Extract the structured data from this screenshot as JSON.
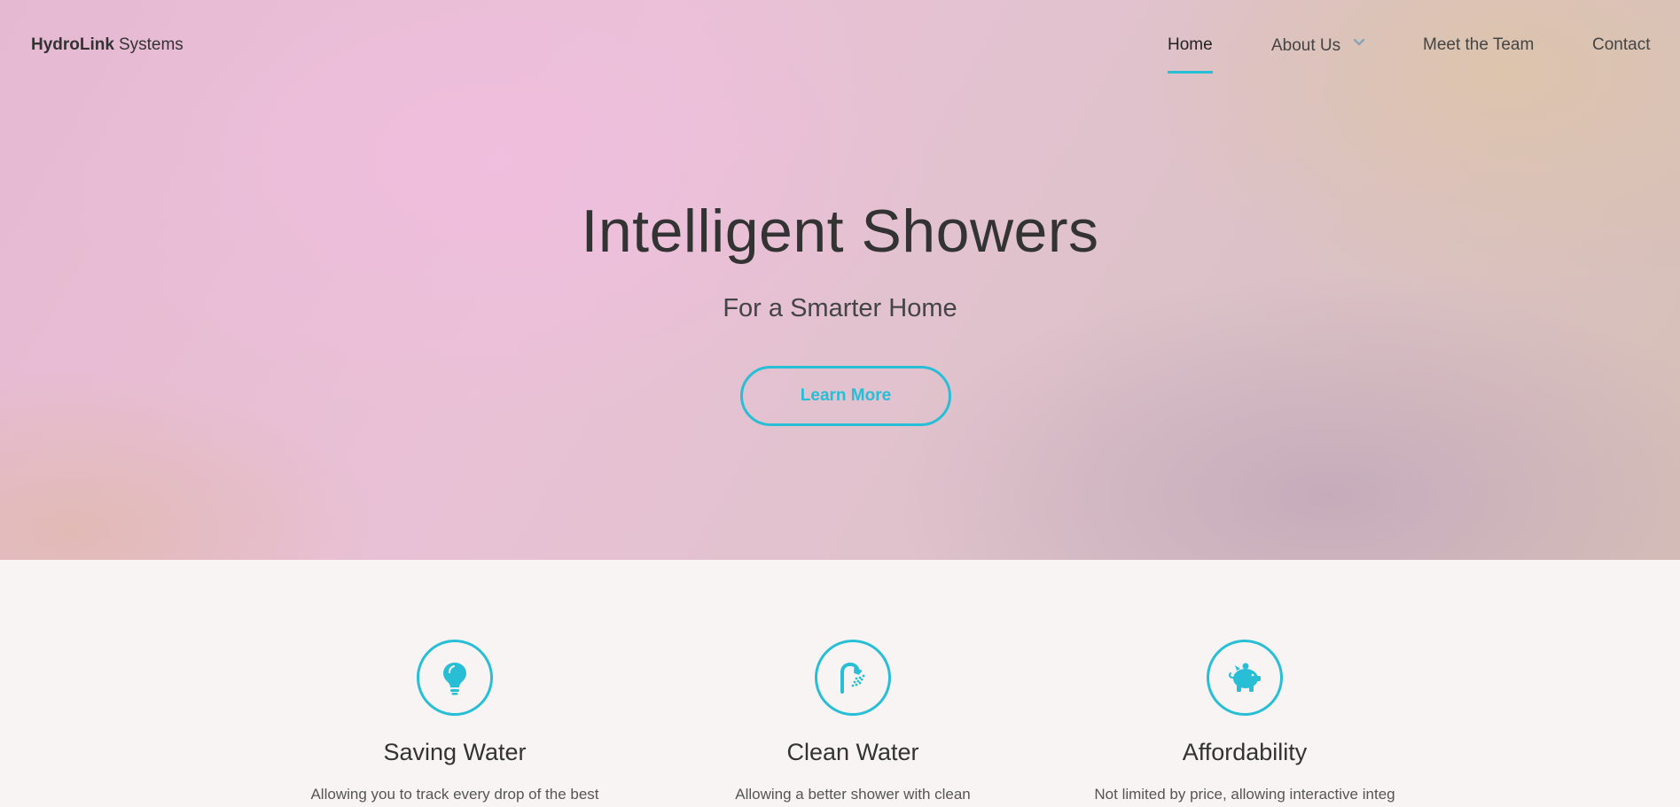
{
  "brand": {
    "name_bold": "HydroLink",
    "name_light": "Systems"
  },
  "nav": {
    "home": "Home",
    "about": "About Us",
    "team": "Meet the Team",
    "contact": "Contact"
  },
  "hero": {
    "title": "Intelligent Showers",
    "subtitle": "For a Smarter Home",
    "cta_label": "Learn More"
  },
  "features": [
    {
      "icon": "lightbulb-icon",
      "title": "Saving Water",
      "text": "Allowing you to track every drop of the best"
    },
    {
      "icon": "shower-icon",
      "title": "Clean Water",
      "text": "Allowing a better shower with clean"
    },
    {
      "icon": "piggy-bank-icon",
      "title": "Affordability",
      "text": "Not limited by price, allowing interactive integ"
    }
  ],
  "colors": {
    "accent": "#28bed6",
    "text": "#333333",
    "hero_pink": "#e9c1d6",
    "hero_tan": "#d6bfb6"
  }
}
